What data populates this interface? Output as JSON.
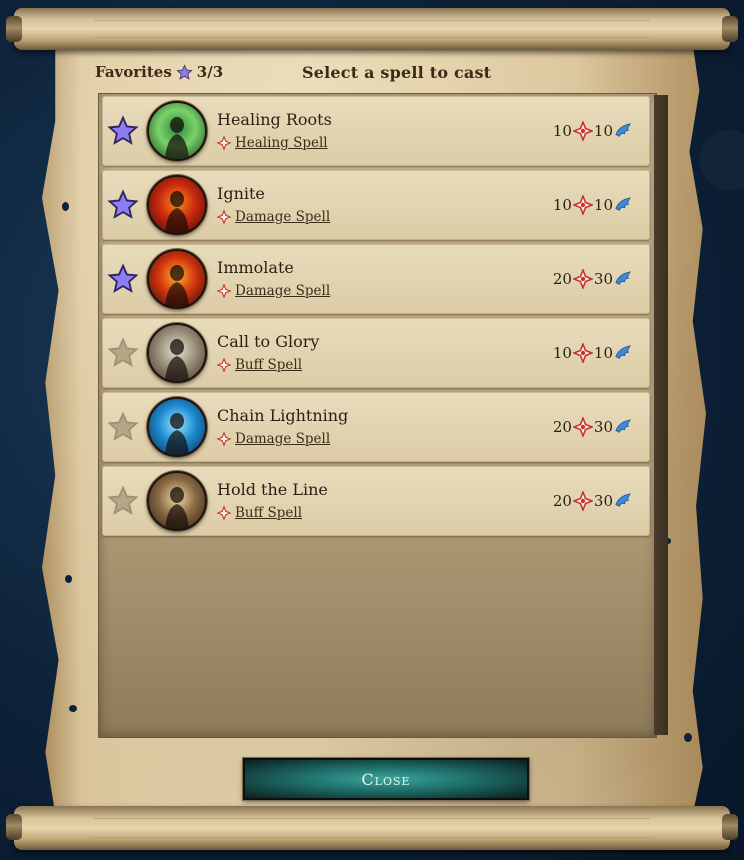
{
  "header": {
    "favorites_label": "Favorites",
    "favorites_count": "3/3",
    "title": "Select a spell to cast"
  },
  "spells": [
    {
      "name": "Healing Roots",
      "type": "Healing Spell",
      "favorite": true,
      "cost_a": "10",
      "cost_b": "10",
      "portrait_icon": "healing-roots-portrait",
      "colors": [
        "#2a8a3a",
        "#7ad26a",
        "#0e3b1a"
      ]
    },
    {
      "name": "Ignite",
      "type": "Damage Spell",
      "favorite": true,
      "cost_a": "10",
      "cost_b": "10",
      "portrait_icon": "ignite-portrait",
      "colors": [
        "#ff8a1a",
        "#c8280e",
        "#3b0a05"
      ]
    },
    {
      "name": "Immolate",
      "type": "Damage Spell",
      "favorite": true,
      "cost_a": "20",
      "cost_b": "30",
      "portrait_icon": "immolate-portrait",
      "colors": [
        "#ffb02a",
        "#d2340f",
        "#2a0805"
      ]
    },
    {
      "name": "Call to Glory",
      "type": "Buff Spell",
      "favorite": false,
      "cost_a": "10",
      "cost_b": "10",
      "portrait_icon": "call-to-glory-portrait",
      "colors": [
        "#e9e3d0",
        "#9a8f7a",
        "#3a2f2a"
      ]
    },
    {
      "name": "Chain Lightning",
      "type": "Damage Spell",
      "favorite": false,
      "cost_a": "20",
      "cost_b": "30",
      "portrait_icon": "chain-lightning-portrait",
      "colors": [
        "#9ae8ff",
        "#1e8ad0",
        "#062a48"
      ]
    },
    {
      "name": "Hold the Line",
      "type": "Buff Spell",
      "favorite": false,
      "cost_a": "20",
      "cost_b": "30",
      "portrait_icon": "hold-the-line-portrait",
      "colors": [
        "#f2d9a8",
        "#8a6a44",
        "#2a1a10"
      ]
    }
  ],
  "close_button": {
    "label": "Close"
  },
  "colors": {
    "favorite_star": "#8c7ef0",
    "empty_star": "#a8977a",
    "cost_red": "#c8342c",
    "cost_blue": "#3a8ad8",
    "close_button": "#1e6c68"
  }
}
